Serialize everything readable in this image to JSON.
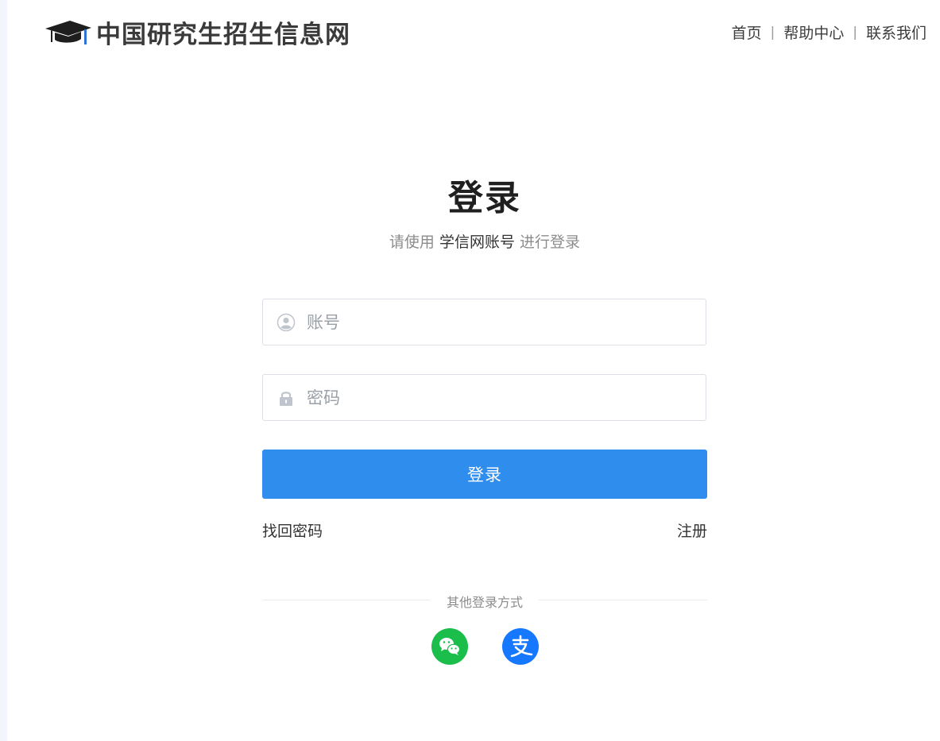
{
  "header": {
    "site_title": "中国研究生招生信息网",
    "nav": [
      {
        "label": "首页"
      },
      {
        "label": "帮助中心"
      },
      {
        "label": "联系我们"
      }
    ],
    "separator": "|"
  },
  "login": {
    "title": "登录",
    "subtitle_prefix": "请使用",
    "subtitle_account": "学信网账号",
    "subtitle_suffix": "进行登录",
    "username_placeholder": "账号",
    "password_placeholder": "密码",
    "submit_label": "登录",
    "forgot_label": "找回密码",
    "register_label": "注册"
  },
  "other_login": {
    "label": "其他登录方式",
    "methods": [
      {
        "icon": "wechat-icon",
        "color": "#1bbd4b"
      },
      {
        "icon": "alipay-icon",
        "color": "#1677ff"
      }
    ]
  },
  "colors": {
    "primary": "#2f8ded",
    "wechat": "#1bbd4b",
    "alipay": "#1677ff"
  }
}
